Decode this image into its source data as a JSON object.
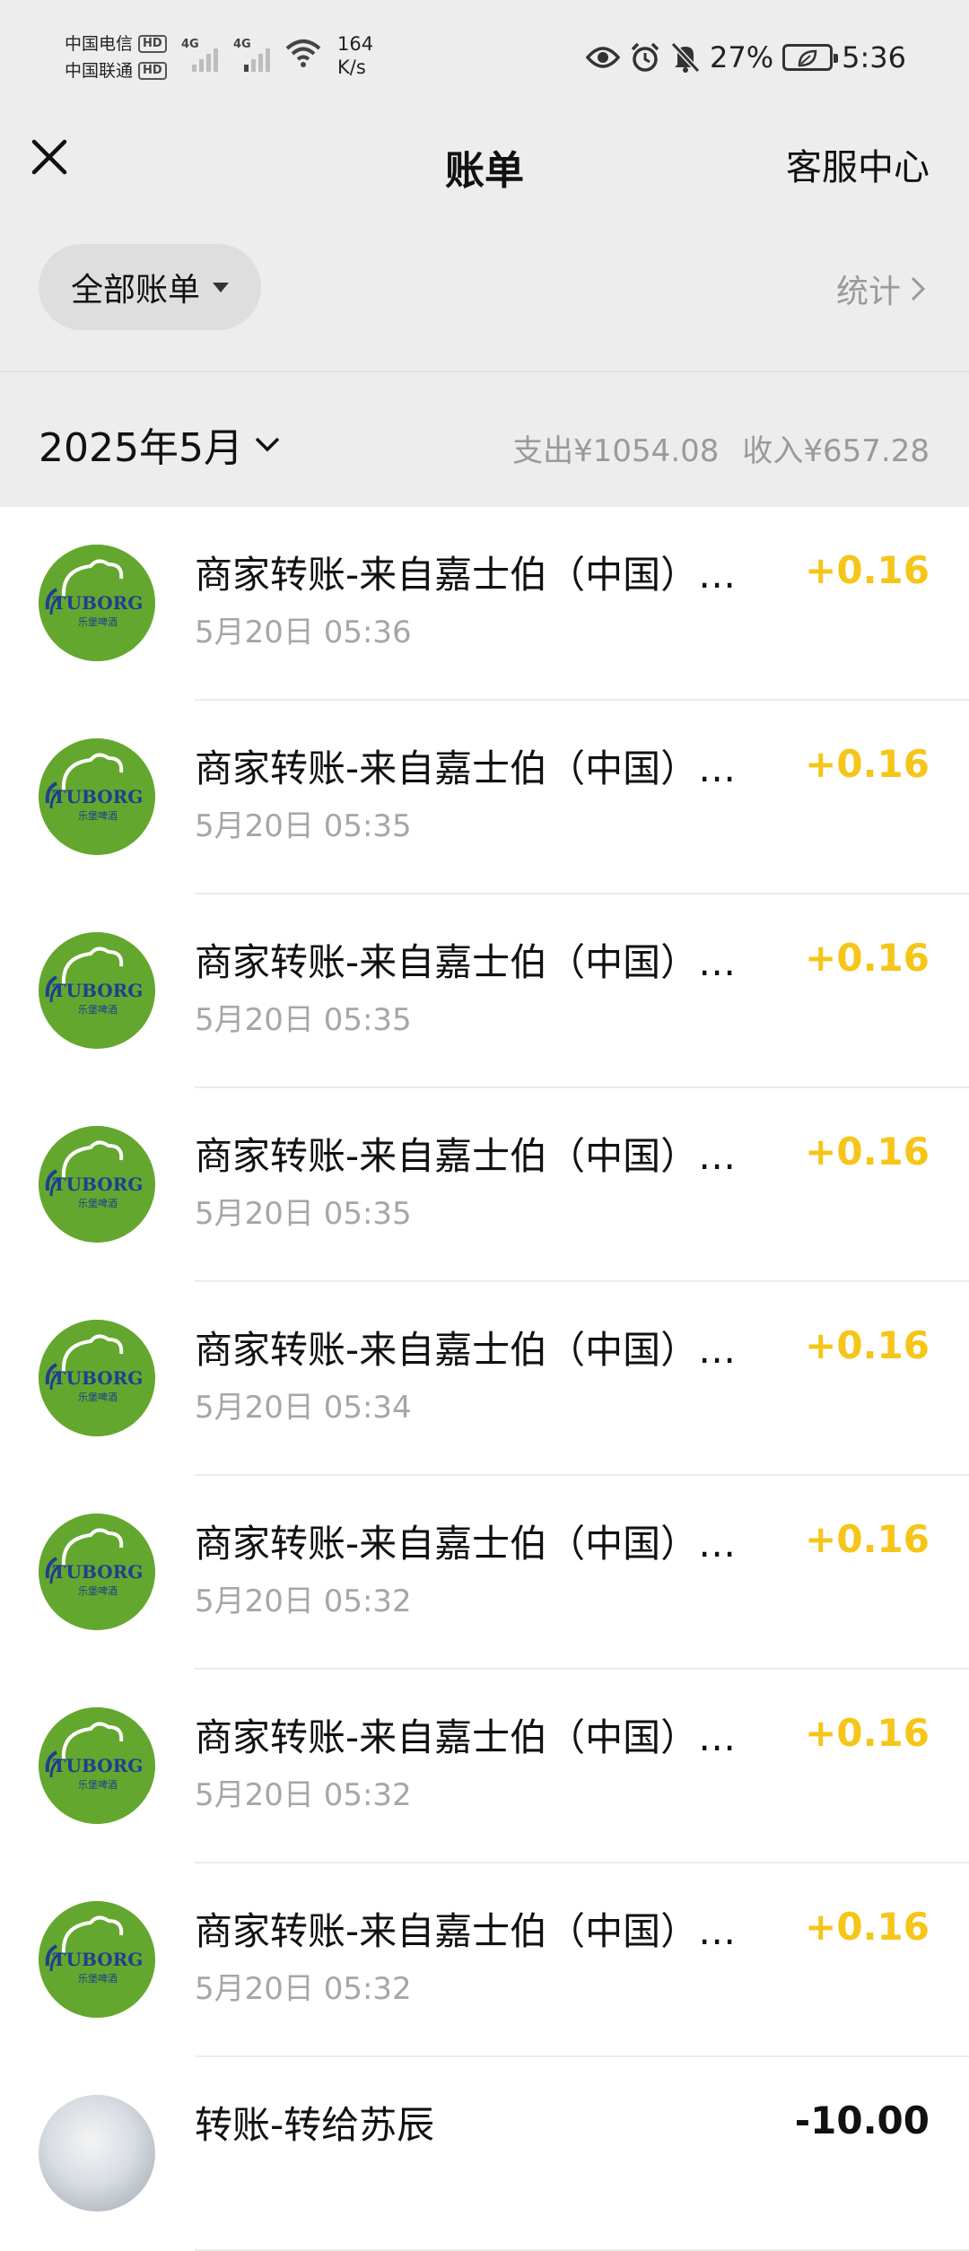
{
  "status_bar": {
    "carrier_1": "中国电信",
    "carrier_2": "中国联通",
    "hd_badge": "HD",
    "signal_tag": "4G",
    "net_speed_value": "164",
    "net_speed_unit": "K/s",
    "battery_percent": "27%",
    "time": "5:36"
  },
  "nav": {
    "title": "账单",
    "service_label": "客服中心"
  },
  "filter": {
    "all_bills_label": "全部账单",
    "stats_label": "统计"
  },
  "month": {
    "label": "2025年5月",
    "expense_summary": "支出¥1054.08",
    "income_summary": "收入¥657.28"
  },
  "logo": {
    "brand": "TUBORG",
    "sub": "乐堡啤酒"
  },
  "transactions": [
    {
      "title": "商家转账-来自嘉士伯（中国）啤酒工贸有限公司",
      "time": "5月20日 05:36",
      "amount": "+0.16",
      "type": "income"
    },
    {
      "title": "商家转账-来自嘉士伯（中国）啤酒工贸有限公司",
      "time": "5月20日 05:35",
      "amount": "+0.16",
      "type": "income"
    },
    {
      "title": "商家转账-来自嘉士伯（中国）啤酒工贸有限公司",
      "time": "5月20日 05:35",
      "amount": "+0.16",
      "type": "income"
    },
    {
      "title": "商家转账-来自嘉士伯（中国）啤酒工贸有限公司",
      "time": "5月20日 05:35",
      "amount": "+0.16",
      "type": "income"
    },
    {
      "title": "商家转账-来自嘉士伯（中国）啤酒工贸有限公司",
      "time": "5月20日 05:34",
      "amount": "+0.16",
      "type": "income"
    },
    {
      "title": "商家转账-来自嘉士伯（中国）啤酒工贸有限公司",
      "time": "5月20日 05:32",
      "amount": "+0.16",
      "type": "income"
    },
    {
      "title": "商家转账-来自嘉士伯（中国）啤酒工贸有限公司",
      "time": "5月20日 05:32",
      "amount": "+0.16",
      "type": "income"
    },
    {
      "title": "商家转账-来自嘉士伯（中国）啤酒工贸有限公司",
      "time": "5月20日 05:32",
      "amount": "+0.16",
      "type": "income"
    },
    {
      "title": "转账-转给苏辰",
      "time": "",
      "amount": "-10.00",
      "type": "expense"
    }
  ],
  "colors": {
    "income": "#f5c518",
    "expense": "#111111",
    "header_bg": "#ededed",
    "logo_green": "#64a72e",
    "logo_blue": "#1f3f8f"
  }
}
